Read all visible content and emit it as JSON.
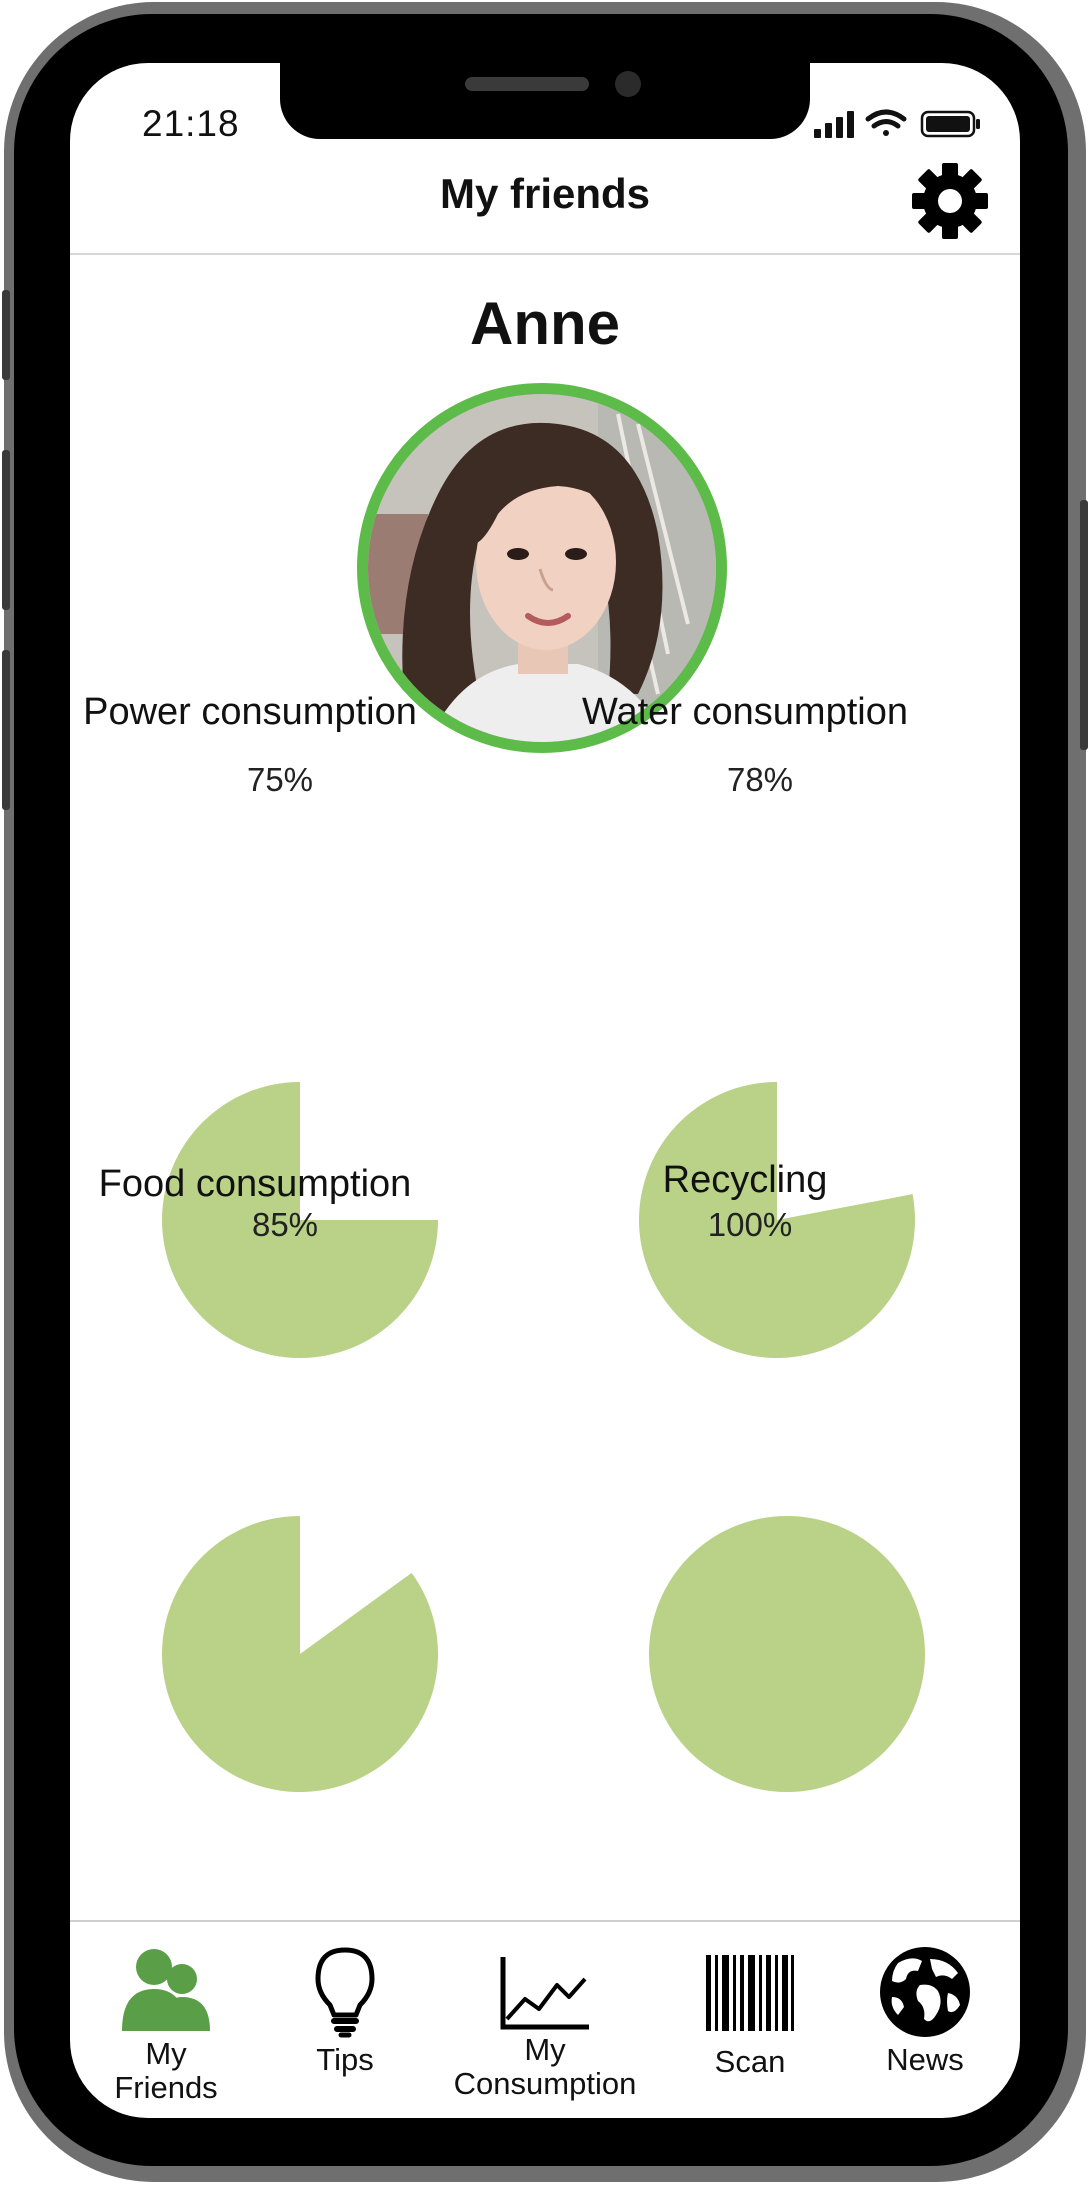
{
  "status_bar": {
    "time": "21:18"
  },
  "header": {
    "title": "My friends",
    "settings_icon": "gear-icon"
  },
  "friend": {
    "name": "Anne",
    "avatar_ring_color": "#5dbb49"
  },
  "stats": [
    {
      "label": "Power consumption",
      "percent_text": "75%",
      "value": 0.75
    },
    {
      "label": "Water consumption",
      "percent_text": "78%",
      "value": 0.78
    },
    {
      "label": "Food consumption",
      "percent_text": "85%",
      "value": 0.85
    },
    {
      "label": "Recycling",
      "percent_text": "100%",
      "value": 1.0
    }
  ],
  "chart_data": [
    {
      "type": "pie",
      "title": "Power consumption",
      "values": [
        75
      ],
      "labels": [
        "75%"
      ]
    },
    {
      "type": "pie",
      "title": "Water consumption",
      "values": [
        78
      ],
      "labels": [
        "78%"
      ]
    },
    {
      "type": "pie",
      "title": "Food consumption",
      "values": [
        85
      ],
      "labels": [
        "85%"
      ]
    },
    {
      "type": "pie",
      "title": "Recycling",
      "values": [
        100
      ],
      "labels": [
        "100%"
      ]
    }
  ],
  "colors": {
    "pie_fill": "#b9d287",
    "accent_green": "#5a9e47"
  },
  "tab_bar": {
    "items": [
      {
        "label": "My Friends",
        "icon": "friends-icon",
        "active": true
      },
      {
        "label": "Tips",
        "icon": "lightbulb-icon",
        "active": false
      },
      {
        "label": "My Consumption",
        "label_line1": "My",
        "label_line2": "Consumption",
        "icon": "line-chart-icon",
        "active": false
      },
      {
        "label": "Scan",
        "icon": "barcode-icon",
        "active": false
      },
      {
        "label": "News",
        "icon": "globe-icon",
        "active": false
      }
    ]
  }
}
